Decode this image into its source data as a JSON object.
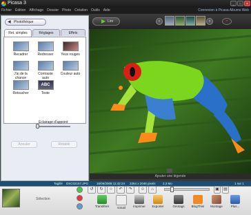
{
  "window": {
    "title": "Picasa 3"
  },
  "menu": {
    "items": [
      "Fichier",
      "Édition",
      "Affichage",
      "Dossier",
      "Photo",
      "Création",
      "Outils",
      "Aide"
    ],
    "account_link": "Connexion à Picasa Albums Web"
  },
  "toolbar": {
    "play_label": "Lire"
  },
  "left_panel": {
    "back_label": "Photothèque",
    "tabs": [
      "Ret. simples",
      "Réglages",
      "Effets"
    ],
    "tools": [
      {
        "label": "Recadrer"
      },
      {
        "label": "Redresser"
      },
      {
        "label": "Yeux rouges"
      },
      {
        "label": "J'ai de la chance"
      },
      {
        "label": "Contraste auto"
      },
      {
        "label": "Couleur auto"
      },
      {
        "label": "Retoucher"
      },
      {
        "label": "Texte"
      }
    ],
    "slider_label": "Éclairage d'appoint",
    "undo_label": "Annuler",
    "redo_label": "Rétablir"
  },
  "photo": {
    "caption": "Ajouter une légende"
  },
  "info_bar": {
    "tag": "Tagillé",
    "filename": "DSC02157.JPG",
    "date": "16/06/2008 11:42:24",
    "dims": "2264 x 2048 pixels",
    "size": "2,3 Mo",
    "count": "1 sur 1"
  },
  "tray": {
    "selection_label": "Sélection",
    "actions": [
      {
        "label": "Transférer",
        "color": "#3a9a3a"
      },
      {
        "label": "Gmail",
        "color": "#d9d9d9"
      },
      {
        "label": "Imprimer",
        "color": "#666666"
      },
      {
        "label": "Exporter",
        "color": "#e0a030"
      },
      {
        "label": "Géotags",
        "color": "#444444"
      },
      {
        "label": "BlogThis!",
        "color": "#f08a24"
      },
      {
        "label": "Montage",
        "color": "#a55a3a"
      },
      {
        "label": "Plus...",
        "color": "#3a6fb5"
      }
    ]
  }
}
